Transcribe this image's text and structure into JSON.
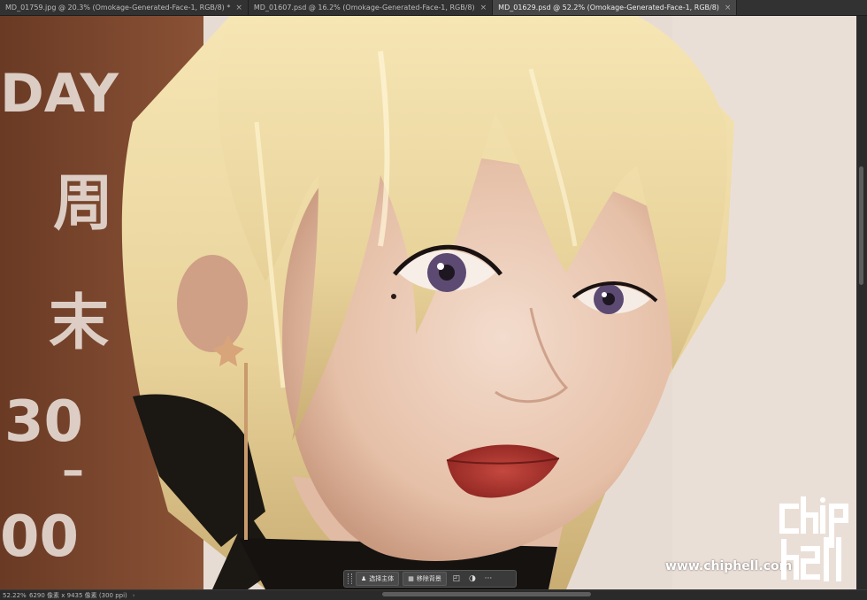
{
  "tabs": [
    {
      "label": "MD_01759.jpg @ 20.3% (Omokage-Generated-Face-1, RGB/8) *",
      "active": false
    },
    {
      "label": "MD_01607.psd @ 16.2% (Omokage-Generated-Face-1, RGB/8)",
      "active": false
    },
    {
      "label": "MD_01629.psd @ 52.2% (Omokage-Generated-Face-1, RGB/8)",
      "active": true
    }
  ],
  "tab_close_glyph": "×",
  "taskbar": {
    "select_subject": "选择主体",
    "remove_background": "移除背景",
    "more": "···"
  },
  "statusbar": {
    "zoom": "52.22%",
    "doc_info": "6290 像素 x 9435 像素 (300 ppi)",
    "arrow": "›"
  },
  "backdrop_text": [
    "DAY",
    "周",
    "末",
    "30",
    "–",
    "00"
  ],
  "watermark": {
    "url": "www.chiphell.com",
    "logo_text": "chiphell"
  },
  "icons": {
    "select_subject": "person-icon",
    "remove_background": "image-icon",
    "transform": "transform-icon",
    "adjust": "contrast-icon"
  }
}
